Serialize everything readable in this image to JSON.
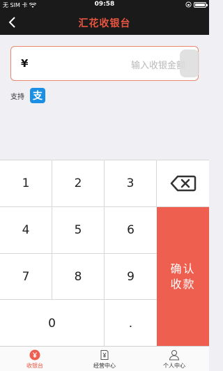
{
  "status": {
    "carrier": "无 SIM 卡",
    "time": "09:58"
  },
  "header": {
    "title": "汇花收银台"
  },
  "amount": {
    "currency": "¥",
    "placeholder": "输入收银金额"
  },
  "support": {
    "label": "支持",
    "alipay_glyph": "支"
  },
  "keypad": {
    "keys": [
      "1",
      "2",
      "3",
      "4",
      "5",
      "6",
      "7",
      "8",
      "9",
      "0",
      "."
    ],
    "confirm_line1": "确认",
    "confirm_line2": "收款"
  },
  "tabs": [
    {
      "label": "收银台",
      "icon": "cashier-icon",
      "active": true
    },
    {
      "label": "经营中心",
      "icon": "business-icon",
      "active": false
    },
    {
      "label": "个人中心",
      "icon": "person-icon",
      "active": false
    }
  ],
  "colors": {
    "accent": "#ee5f4f",
    "header_bg": "#1a1a1a",
    "alipay": "#1a8fe3"
  }
}
